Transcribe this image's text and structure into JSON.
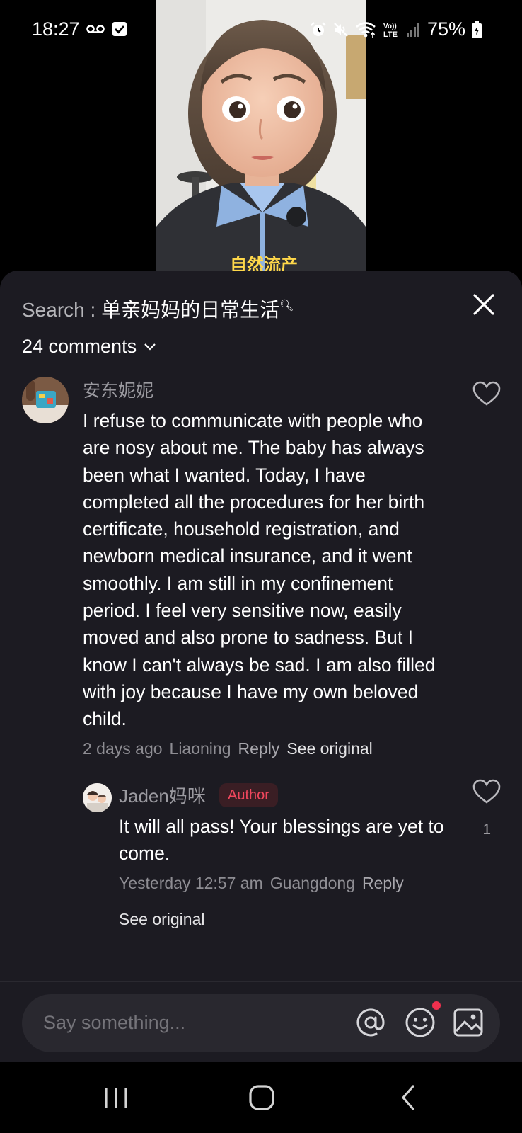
{
  "status_bar": {
    "time": "18:27",
    "battery": "75%",
    "icons": [
      "voicemail-icon",
      "check-box-icon",
      "alarm-icon",
      "mute-icon",
      "wifi-icon",
      "volte-icon",
      "signal-icon",
      "battery-icon"
    ],
    "volte_label": "Vo))\nLTE"
  },
  "video": {
    "caption": "自然流产"
  },
  "comments": {
    "search_prefix": "Search : ",
    "search_term": "单亲妈妈的日常生活",
    "count_label": "24 comments",
    "items": [
      {
        "username": "安东妮妮",
        "text": "I refuse to communicate with people who are nosy about me. The baby has always been what I wanted. Today, I have completed all the procedures for her birth certificate, household registration, and newborn medical insurance, and it went smoothly. I am still in my confinement period. I feel very sensitive now, easily moved and also prone to sadness. But I know I can't always be sad. I am also filled with joy because I have my own beloved child.",
        "time": "2 days ago",
        "location": "Liaoning",
        "reply_label": "Reply",
        "see_original": "See original",
        "replies": [
          {
            "username": "Jaden妈咪",
            "badge": "Author",
            "text": "It will all pass! Your blessings are yet to come.",
            "time": "Yesterday 12:57 am",
            "location": "Guangdong",
            "reply_label": "Reply",
            "see_original": "See original",
            "likes": "1"
          }
        ]
      }
    ]
  },
  "input": {
    "placeholder": "Say something..."
  },
  "colors": {
    "sheet_bg": "#1c1b22",
    "author_badge": "#f0475d",
    "notification_dot": "#f0304e"
  }
}
